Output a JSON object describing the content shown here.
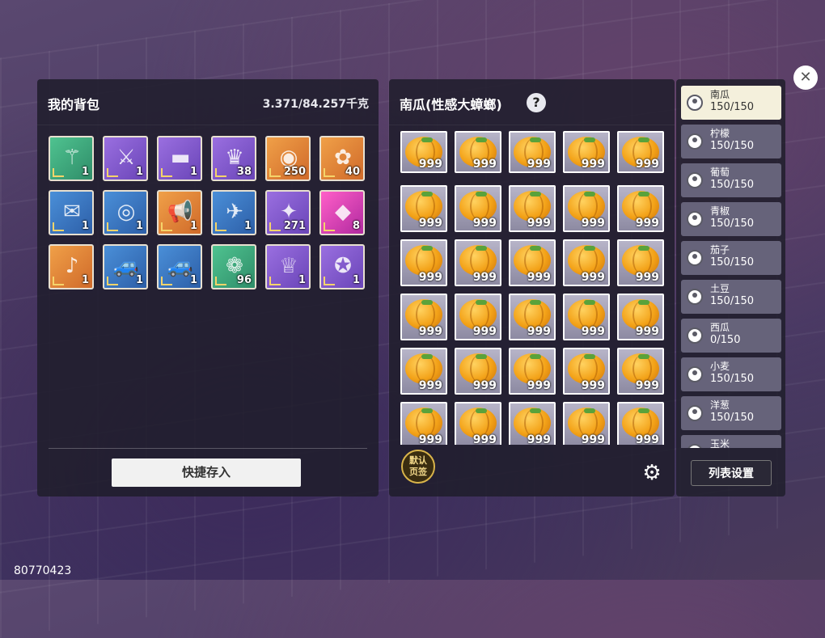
{
  "backpack": {
    "title": "我的背包",
    "weight": "3.371/84.257千克",
    "items": [
      {
        "icon": "staff-icon",
        "count": "1",
        "bg": "green"
      },
      {
        "icon": "sword-icon",
        "count": "1",
        "bg": "purple"
      },
      {
        "icon": "rifle-icon",
        "count": "1",
        "bg": "purple"
      },
      {
        "icon": "shirt-icon",
        "count": "38",
        "bg": "purple"
      },
      {
        "icon": "coin-icon",
        "count": "250",
        "bg": "orange"
      },
      {
        "icon": "gem-icon",
        "count": "40",
        "bg": "orange"
      },
      {
        "icon": "ticket-icon",
        "count": "1",
        "bg": "blue"
      },
      {
        "icon": "disc-icon",
        "count": "1",
        "bg": "blue"
      },
      {
        "icon": "megaphone-icon",
        "count": "1",
        "bg": "orange"
      },
      {
        "icon": "drone-icon",
        "count": "1",
        "bg": "blue"
      },
      {
        "icon": "scroll-icon",
        "count": "271",
        "bg": "purple"
      },
      {
        "icon": "egg-crystal-icon",
        "count": "8",
        "bg": "pink"
      },
      {
        "icon": "horn-icon",
        "count": "1",
        "bg": "orange"
      },
      {
        "icon": "car-icon",
        "count": "1",
        "bg": "blue"
      },
      {
        "icon": "car-icon",
        "count": "1",
        "bg": "blue"
      },
      {
        "icon": "food-plate-icon",
        "count": "96",
        "bg": "green"
      },
      {
        "icon": "princess-icon",
        "count": "1",
        "bg": "purple"
      },
      {
        "icon": "compass-icon",
        "count": "1",
        "bg": "purple"
      }
    ],
    "quick_store": "快捷存入"
  },
  "storage": {
    "title": "南瓜(性感大蟑螂)",
    "help": "?",
    "item_count": "999",
    "slot_count": 30,
    "default_badge": [
      "默认",
      "页签"
    ]
  },
  "crops": [
    {
      "name": "南瓜",
      "qty": "150/150",
      "selected": true
    },
    {
      "name": "柠檬",
      "qty": "150/150"
    },
    {
      "name": "葡萄",
      "qty": "150/150"
    },
    {
      "name": "青椒",
      "qty": "150/150"
    },
    {
      "name": "茄子",
      "qty": "150/150"
    },
    {
      "name": "土豆",
      "qty": "150/150"
    },
    {
      "name": "西瓜",
      "qty": "0/150"
    },
    {
      "name": "小麦",
      "qty": "150/150"
    },
    {
      "name": "洋葱",
      "qty": "150/150"
    },
    {
      "name": "玉米",
      "qty": ""
    }
  ],
  "list_settings": "列表设置",
  "close": "✕",
  "uid": "80770423"
}
